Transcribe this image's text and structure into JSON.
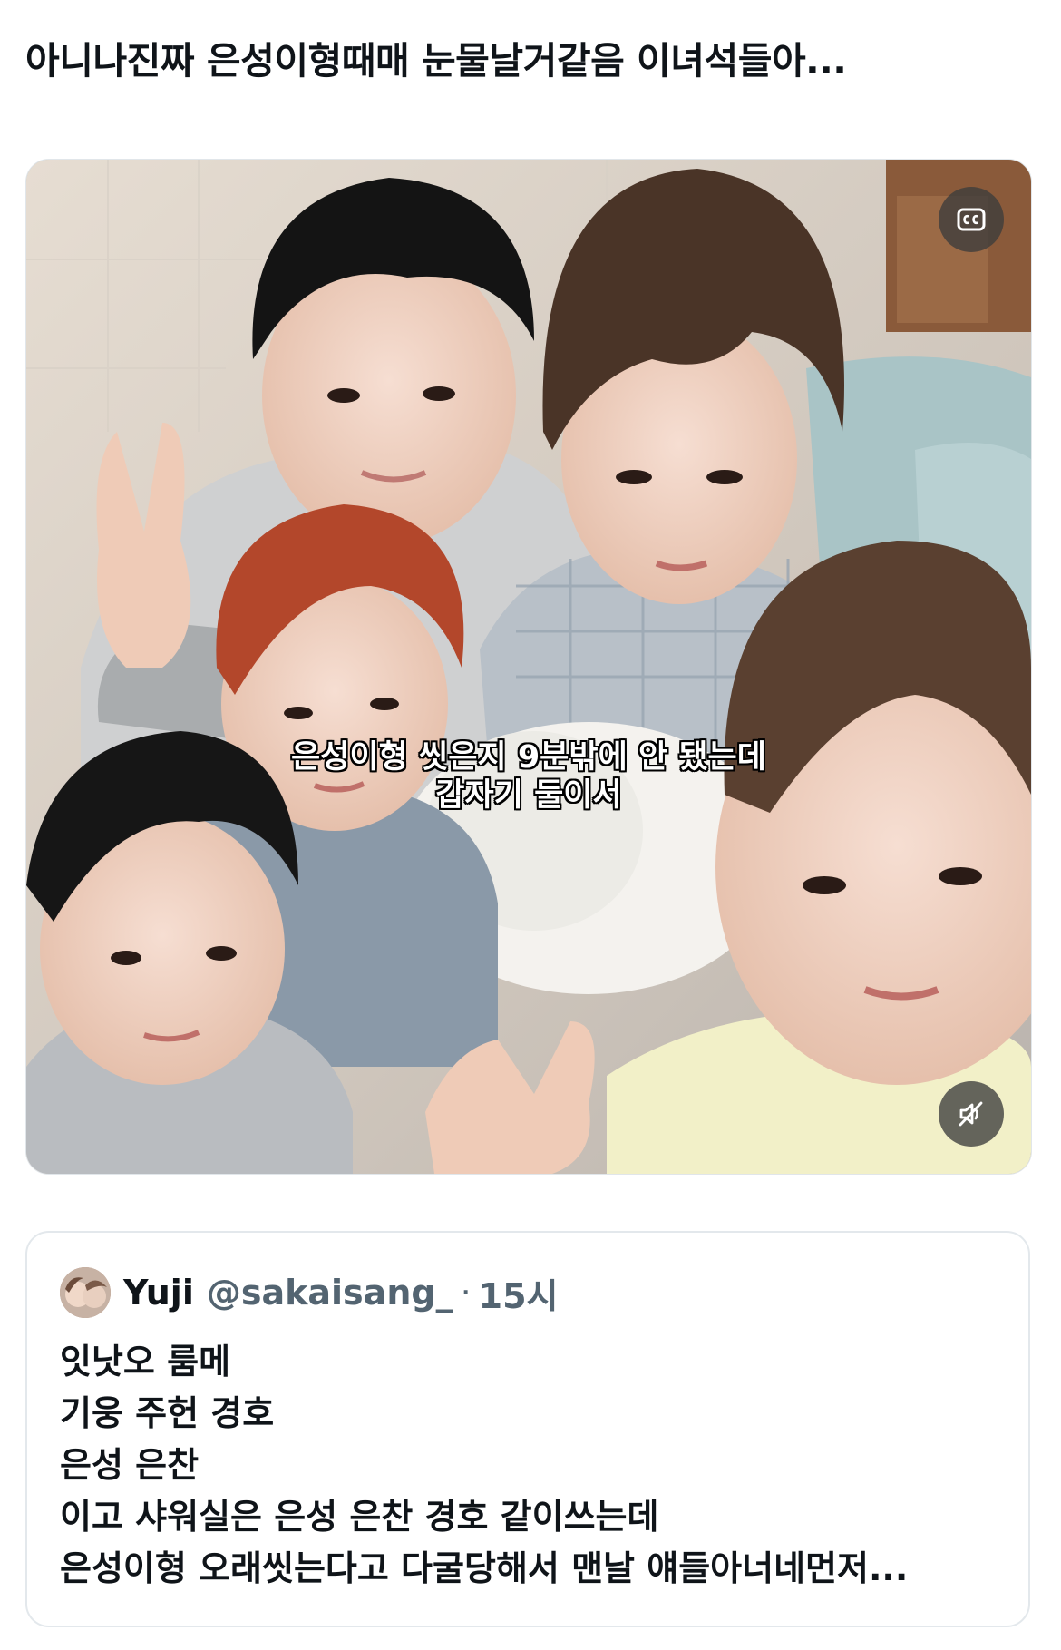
{
  "post": {
    "text": "아니나진짜 은성이형때매 눈물날거같음 이녀석들아..."
  },
  "media": {
    "type": "video",
    "subtitle_line1": "은성이형 씻은지 9분밖에 안 됐는데",
    "subtitle_line2": "갑자기 둘이서",
    "cc_icon": "closed-captions-icon",
    "mute_icon": "speaker-muted-icon"
  },
  "quote": {
    "display_name": "Yuji",
    "handle": "@sakaisang_",
    "separator": "·",
    "time": "15시",
    "lines": [
      "잇낫오 룸메",
      "기웅 주헌 경호",
      "은성 은찬",
      "이고 샤워실은 은성 은찬 경호 같이쓰는데",
      "은성이형 오래씻는다고 다굴당해서 맨날 얘들아너네먼저..."
    ]
  },
  "colors": {
    "text": "#0f1419",
    "secondary_text": "#536471",
    "border": "#e3e8ec",
    "overlay_button": "#3c3c3c"
  }
}
